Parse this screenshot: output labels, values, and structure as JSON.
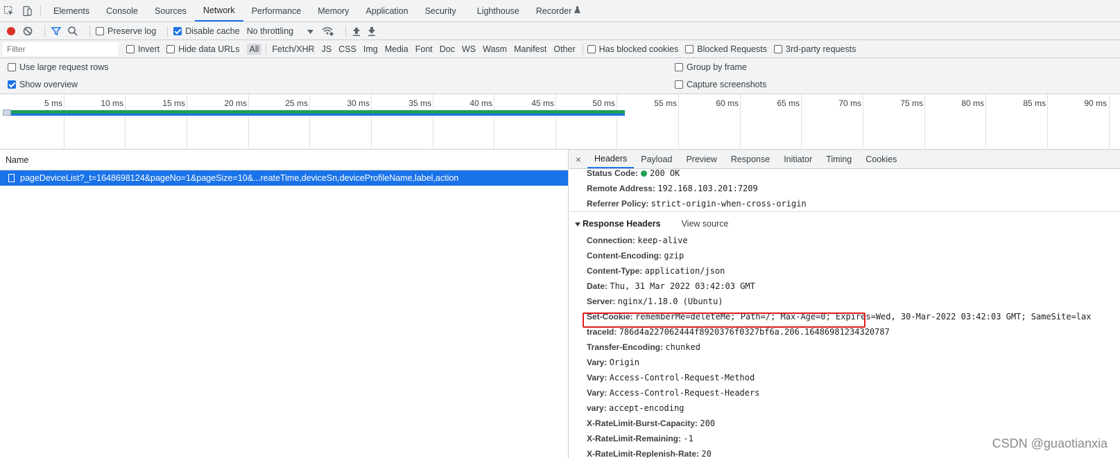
{
  "tabbar": {
    "tabs": [
      "Elements",
      "Console",
      "Sources",
      "Network",
      "Performance",
      "Memory",
      "Application",
      "Security",
      "Lighthouse",
      "Recorder"
    ],
    "active": "Network"
  },
  "toolbar": {
    "preserve_log": "Preserve log",
    "disable_cache": "Disable cache",
    "throttling": "No throttling"
  },
  "filterbar": {
    "placeholder": "Filter",
    "invert": "Invert",
    "hide_data_urls": "Hide data URLs",
    "types": [
      "All",
      "Fetch/XHR",
      "JS",
      "CSS",
      "Img",
      "Media",
      "Font",
      "Doc",
      "WS",
      "Wasm",
      "Manifest",
      "Other"
    ],
    "has_blocked_cookies": "Has blocked cookies",
    "blocked_requests": "Blocked Requests",
    "third_party": "3rd-party requests"
  },
  "options": {
    "large_rows": "Use large request rows",
    "show_overview": "Show overview",
    "group_by_frame": "Group by frame",
    "capture_screenshots": "Capture screenshots"
  },
  "overview": {
    "ticks": [
      "5 ms",
      "10 ms",
      "15 ms",
      "20 ms",
      "25 ms",
      "30 ms",
      "35 ms",
      "40 ms",
      "45 ms",
      "50 ms",
      "55 ms",
      "60 ms",
      "65 ms",
      "70 ms",
      "75 ms",
      "80 ms",
      "85 ms",
      "90 ms"
    ]
  },
  "requests": {
    "header": "Name",
    "row": "pageDeviceList?_t=1648698124&pageNo=1&pageSize=10&...reateTime,deviceSn,deviceProfileName,label,action"
  },
  "details": {
    "close": "×",
    "tabs": [
      "Headers",
      "Payload",
      "Preview",
      "Response",
      "Initiator",
      "Timing",
      "Cookies"
    ],
    "general": {
      "status_code_name": "Status Code:",
      "status_code_value": "200 OK",
      "remote_address_name": "Remote Address:",
      "remote_address_value": "192.168.103.201:7209",
      "referrer_policy_name": "Referrer Policy:",
      "referrer_policy_value": "strict-origin-when-cross-origin"
    },
    "response_headers_title": "Response Headers",
    "view_source": "View source",
    "headers": [
      {
        "name": "Connection:",
        "value": "keep-alive"
      },
      {
        "name": "Content-Encoding:",
        "value": "gzip"
      },
      {
        "name": "Content-Type:",
        "value": "application/json"
      },
      {
        "name": "Date:",
        "value": "Thu, 31 Mar 2022 03:42:03 GMT"
      },
      {
        "name": "Server:",
        "value": "nginx/1.18.0 (Ubuntu)"
      },
      {
        "name": "Set-Cookie:",
        "value": "rememberMe=deleteMe; Path=/; Max-Age=0; Expires=Wed, 30-Mar-2022 03:42:03 GMT; SameSite=lax"
      },
      {
        "name": "traceId:",
        "value": "786d4a227062444f8920376f0327bf6a.206.16486981234320787"
      },
      {
        "name": "Transfer-Encoding:",
        "value": "chunked"
      },
      {
        "name": "Vary:",
        "value": "Origin"
      },
      {
        "name": "Vary:",
        "value": "Access-Control-Request-Method"
      },
      {
        "name": "Vary:",
        "value": "Access-Control-Request-Headers"
      },
      {
        "name": "vary:",
        "value": "accept-encoding"
      },
      {
        "name": "X-RateLimit-Burst-Capacity:",
        "value": "200"
      },
      {
        "name": "X-RateLimit-Remaining:",
        "value": "-1"
      },
      {
        "name": "X-RateLimit-Replenish-Rate:",
        "value": "20"
      }
    ]
  },
  "watermark": "CSDN @guaotianxia",
  "colors": {
    "accent": "#1a73e8",
    "record": "#d93025",
    "status_ok": "#1e9e55",
    "highlight": "#e01b1b"
  }
}
